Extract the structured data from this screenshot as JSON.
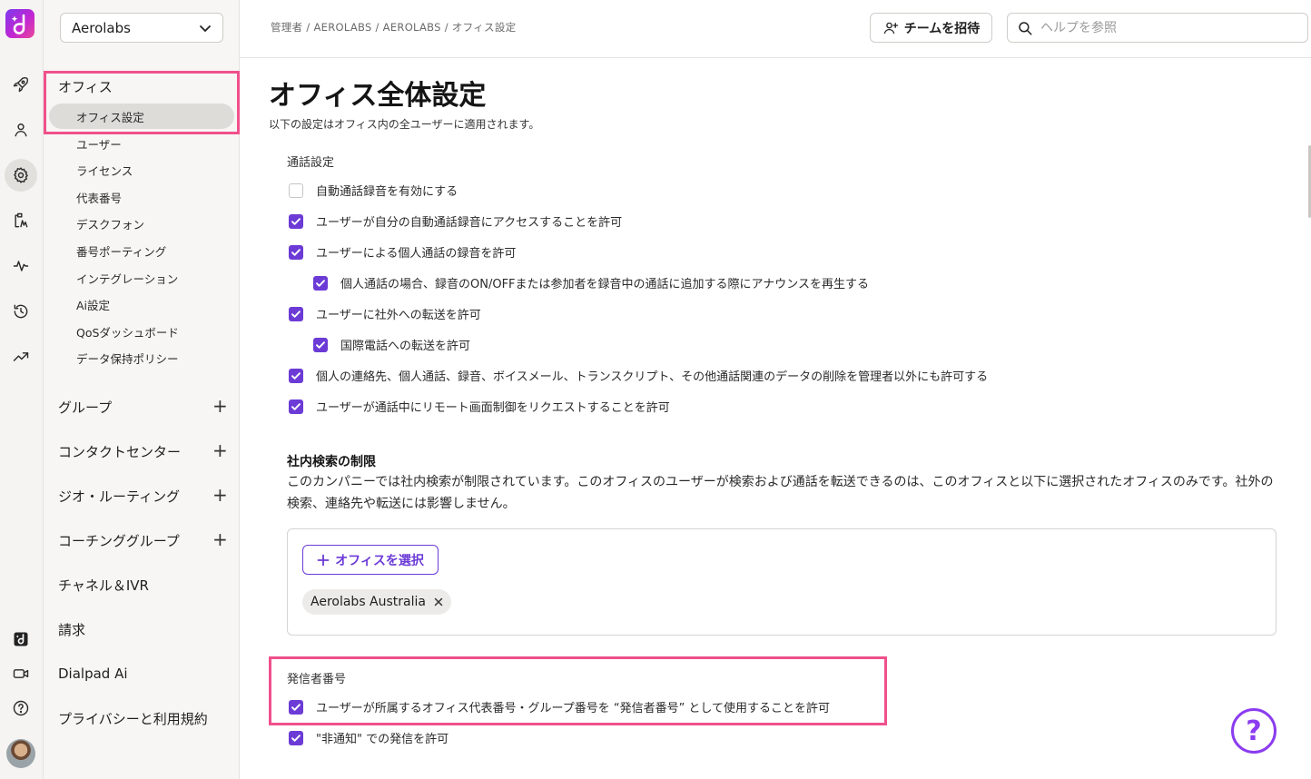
{
  "rail": {
    "icons": [
      "rocket-icon",
      "person-icon",
      "gear-icon",
      "contact-center-icon",
      "activity-icon",
      "history-icon",
      "trend-icon",
      "dialpad-ai-icon",
      "video-icon",
      "help-circle-icon"
    ]
  },
  "sidebar": {
    "org_select": "Aerolabs",
    "office_section": "オフィス",
    "office_items": [
      "オフィス設定",
      "ユーザー",
      "ライセンス",
      "代表番号",
      "デスクフォン",
      "番号ポーティング",
      "インテグレーション",
      "Ai設定",
      "QoSダッシュボード",
      "データ保持ポリシー"
    ],
    "groups": [
      {
        "label": "グループ",
        "expandable": true
      },
      {
        "label": "コンタクトセンター",
        "expandable": true
      },
      {
        "label": "ジオ・ルーティング",
        "expandable": true
      },
      {
        "label": "コーチンググループ",
        "expandable": true
      },
      {
        "label": "チャネル＆IVR",
        "expandable": false
      },
      {
        "label": "請求",
        "expandable": false
      },
      {
        "label": "Dialpad Ai",
        "expandable": false
      },
      {
        "label": "プライバシーと利用規約",
        "expandable": false
      }
    ]
  },
  "header": {
    "breadcrumb": "管理者 / AEROLABS / AEROLABS / オフィス設定",
    "invite_label": "チームを招待",
    "search_placeholder": "ヘルプを参照"
  },
  "main": {
    "title": "オフィス全体設定",
    "subtitle": "以下の設定はオフィス内の全ユーザーに適用されます。",
    "call_settings_label": "通話設定",
    "call_settings": [
      {
        "label": "自動通話録音を有効にする",
        "checked": false
      },
      {
        "label": "ユーザーが自分の自動通話録音にアクセスすることを許可",
        "checked": true
      },
      {
        "label": "ユーザーによる個人通話の録音を許可",
        "checked": true
      },
      {
        "label": "個人通話の場合、録音のON/OFFまたは参加者を録音中の通話に追加する際にアナウンスを再生する",
        "checked": true
      },
      {
        "label": "ユーザーに社外への転送を許可",
        "checked": true
      },
      {
        "label": "国際電話への転送を許可",
        "checked": true
      },
      {
        "label": "個人の連絡先、個人通話、録音、ボイスメール、トランスクリプト、その他通話関連のデータの削除を管理者以外にも許可する",
        "checked": true
      },
      {
        "label": "ユーザーが通話中にリモート画面制御をリクエストすることを許可",
        "checked": true
      }
    ],
    "search_restriction": {
      "title": "社内検索の制限",
      "description": "このカンパニーでは社内検索が制限されています。このオフィスのユーザーが検索および通話を転送できるのは、このオフィスと以下に選択されたオフィスのみです。社外の検索、連絡先や転送には影響しません。",
      "select_button": "オフィスを選択",
      "selected_offices": [
        "Aerolabs Australia"
      ]
    },
    "caller_id": {
      "label": "発信者番号",
      "options": [
        {
          "label": "ユーザーが所属するオフィス代表番号・グループ番号を “発信者番号” として使用することを許可",
          "checked": true
        },
        {
          "label": "\"非通知\" での発信を許可",
          "checked": true
        }
      ]
    },
    "help_glyph": "?"
  },
  "colors": {
    "accent": "#6c3bd6",
    "highlight": "#f0508c",
    "logo_gradient_start": "#7c3aed",
    "logo_gradient_end": "#ec4899"
  }
}
